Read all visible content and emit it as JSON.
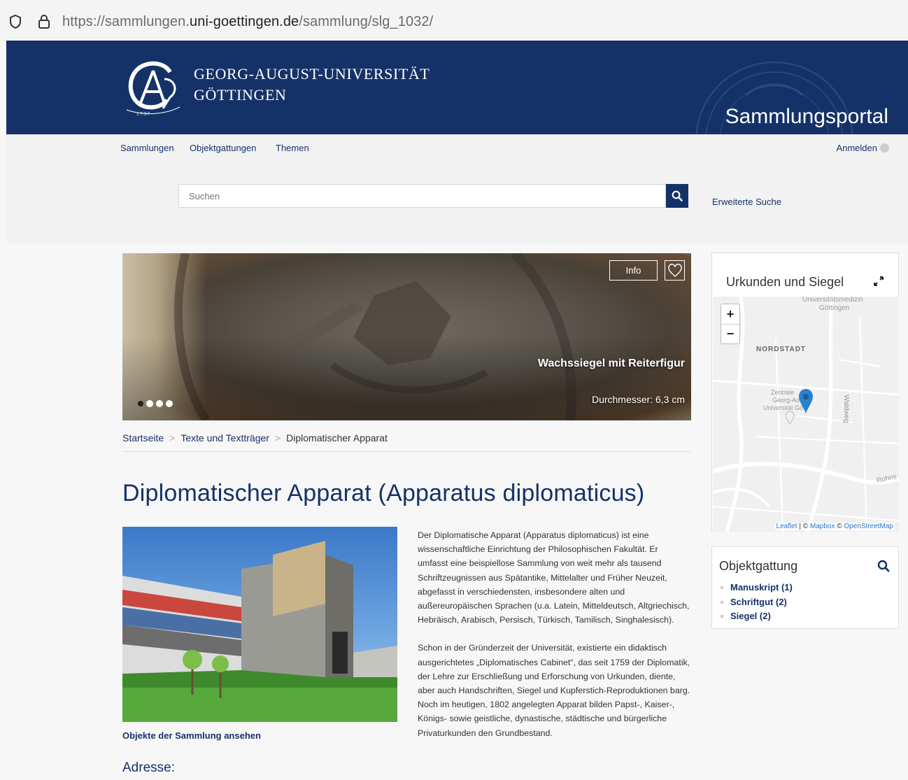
{
  "browser": {
    "url_prefix": "https://sammlungen.",
    "url_domain": "uni-goettingen.de",
    "url_path": "/sammlung/slg_1032/"
  },
  "header": {
    "uni_line1": "GEORG-AUGUST-UNIVERSITÄT",
    "uni_line2": "GÖTTINGEN",
    "portal_title": "Sammlungsportal"
  },
  "nav": {
    "items": [
      "Sammlungen",
      "Objektgattungen",
      "Themen"
    ],
    "login": "Anmelden"
  },
  "search": {
    "placeholder": "Suchen",
    "advanced": "Erweiterte Suche"
  },
  "hero": {
    "info_label": "Info",
    "caption": "Wachssiegel mit Reiterfigur",
    "subcaption": "Durchmesser: 6,3 cm",
    "slide_count": 4,
    "active_slide": 1
  },
  "breadcrumb": [
    "Startseite",
    "Texte und Textträger",
    "Diplomatischer Apparat"
  ],
  "page_title": "Diplomatischer Apparat (Apparatus diplomaticus)",
  "photo_link": "Objekte der Sammlung ansehen",
  "address_title": "Adresse:",
  "body": {
    "p1": "Der Diplomatische Apparat (Apparatus diplomaticus) ist eine wissenschaftliche Einrichtung der Philosophischen Fakultät. Er umfasst eine beispiellose Sammlung von weit mehr als tausend Schriftzeugnissen aus Spätantike, Mittelalter und Früher Neuzeit, abgefasst in verschiedensten, insbesondere alten und außereuropäischen Sprachen (u.a. Latein, Mitteldeutsch, Altgriechisch, Hebräisch, Arabisch, Persisch, Türkisch, Tamilisch, Singhalesisch).",
    "p2": "Schon in der Gründerzeit der Universität, existierte ein didaktisch ausgerichtetes „Diplomatisches Cabinet“, das seit 1759 der Diplomatik, der Lehre zur Erschließung und Erforschung von Urkunden, diente, aber auch Handschriften, Siegel und Kupferstich-Reproduktionen barg. Noch im heutigen, 1802 angelegten Apparat bilden Papst-, Kaiser-, Königs- sowie geistliche, dynastische, städtische und bürgerliche Privaturkunden den Grundbestand."
  },
  "map": {
    "title": "Urkunden und Siegel",
    "zoom_in": "+",
    "zoom_out": "−",
    "labels": {
      "umg1": "Universitätsmedizin",
      "umg2": "Göttingen",
      "nordstadt": "NORDSTADT",
      "zb1": "Zentrale",
      "zb2": "Georg-Au",
      "zb3": "Universität Gö",
      "waldweg": "Waldweg",
      "rohns": "Rohns"
    },
    "attribution": {
      "leaflet": "Leaflet",
      "sep1": " | © ",
      "mapbox": "Mapbox",
      "sep2": " © ",
      "osm": "OpenStreetMap"
    }
  },
  "facets": {
    "title": "Objektgattung",
    "items": [
      "Manuskript (1)",
      "Schriftgut (2)",
      "Siegel (2)"
    ]
  },
  "colors": {
    "brand": "#153268",
    "page_bg": "#f7f7f7"
  }
}
